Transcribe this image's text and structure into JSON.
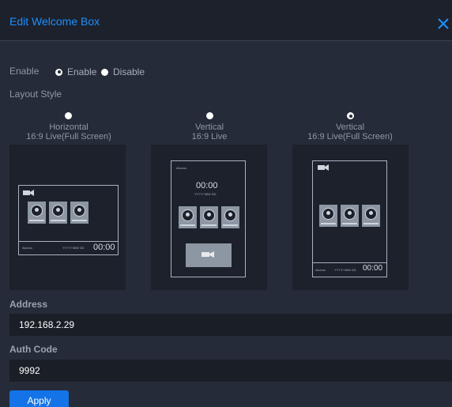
{
  "dialog": {
    "title": "Edit Welcome Box",
    "close_icon": "close-icon"
  },
  "enable": {
    "label": "Enable",
    "options": [
      {
        "label": "Enable",
        "selected": true
      },
      {
        "label": "Disable",
        "selected": false
      }
    ]
  },
  "layout": {
    "label": "Layout Style",
    "options": [
      {
        "line1": "Horizontal",
        "line2": "16:9 Live(Full Screen)",
        "selected": false
      },
      {
        "line1": "Vertical",
        "line2": "16:9 Live",
        "selected": false
      },
      {
        "line1": "Vertical",
        "line2": "16:9 Live(Full Screen)",
        "selected": true
      }
    ],
    "preview": {
      "brand": "Akuvox",
      "date_format": "YYYY/ MM/ DD",
      "time": "00:00"
    }
  },
  "address": {
    "label": "Address",
    "value": "192.168.2.29"
  },
  "auth_code": {
    "label": "Auth Code",
    "value": "9992"
  },
  "apply_label": "Apply",
  "colors": {
    "accent": "#1e8fff",
    "button": "#1473e6",
    "background": "#252b38"
  }
}
